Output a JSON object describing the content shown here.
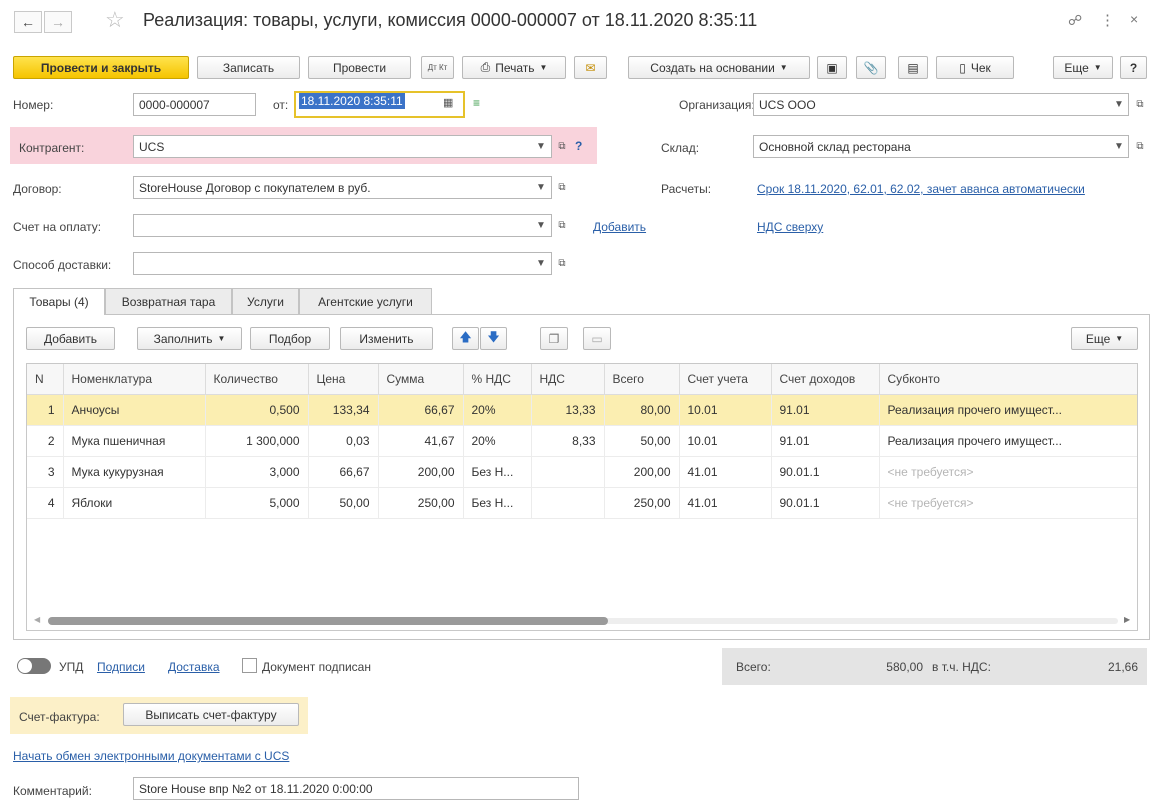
{
  "window": {
    "title": "Реализация: товары, услуги, комиссия 0000-000007 от 18.11.2020 8:35:11",
    "link_icon": "link-icon",
    "more_icon": "more-vertical-icon",
    "close_icon": "close-icon"
  },
  "toolbar": {
    "post_close": "Провести и закрыть",
    "save": "Записать",
    "post": "Провести",
    "dt_kt": "Дт Кт",
    "print": "Печать",
    "create_based": "Создать на основании",
    "receipt": "Чек",
    "more": "Еще",
    "help": "?"
  },
  "form": {
    "number_label": "Номер:",
    "number_value": "0000-000007",
    "date_label": "от:",
    "date_value": "18.11.2020  8:35:11",
    "organization_label": "Организация:",
    "organization_value": "UCS ООО",
    "counterparty_label": "Контрагент:",
    "counterparty_value": "UCS",
    "warehouse_label": "Склад:",
    "warehouse_value": "Основной склад ресторана",
    "contract_label": "Договор:",
    "contract_value": "StoreHouse Договор с покупателем в руб.",
    "settlements_label": "Расчеты:",
    "settlements_link": "Срок 18.11.2020, 62.01, 62.02, зачет аванса автоматически",
    "invoice_label": "Счет на оплату:",
    "invoice_value": "",
    "add_link": "Добавить",
    "vat_link": "НДС сверху",
    "delivery_label": "Способ доставки:",
    "delivery_value": ""
  },
  "tabs": [
    {
      "label": "Товары (4)"
    },
    {
      "label": "Возвратная тара"
    },
    {
      "label": "Услуги"
    },
    {
      "label": "Агентские услуги"
    }
  ],
  "table_toolbar": {
    "add": "Добавить",
    "fill": "Заполнить",
    "pick": "Подбор",
    "change": "Изменить",
    "more": "Еще"
  },
  "table": {
    "columns": [
      "N",
      "Номенклатура",
      "Количество",
      "Цена",
      "Сумма",
      "% НДС",
      "НДС",
      "Всего",
      "Счет учета",
      "Счет доходов",
      "Субконто"
    ],
    "rows": [
      {
        "n": "1",
        "name": "Анчоусы",
        "qty": "0,500",
        "price": "133,34",
        "sum": "66,67",
        "vat_rate": "20%",
        "vat": "13,33",
        "total": "80,00",
        "account": "10.01",
        "income": "91.01",
        "subconto": "Реализация прочего имущест..."
      },
      {
        "n": "2",
        "name": "Мука пшеничная",
        "qty": "1 300,000",
        "price": "0,03",
        "sum": "41,67",
        "vat_rate": "20%",
        "vat": "8,33",
        "total": "50,00",
        "account": "10.01",
        "income": "91.01",
        "subconto": "Реализация прочего имущест..."
      },
      {
        "n": "3",
        "name": "Мука кукурузная",
        "qty": "3,000",
        "price": "66,67",
        "sum": "200,00",
        "vat_rate": "Без Н...",
        "vat": "",
        "total": "200,00",
        "account": "41.01",
        "income": "90.01.1",
        "subconto": "<не требуется>"
      },
      {
        "n": "4",
        "name": "Яблоки",
        "qty": "5,000",
        "price": "50,00",
        "sum": "250,00",
        "vat_rate": "Без Н...",
        "vat": "",
        "total": "250,00",
        "account": "41.01",
        "income": "90.01.1",
        "subconto": "<не требуется>"
      }
    ]
  },
  "footer": {
    "upd_label": "УПД",
    "signatures_link": "Подписи",
    "delivery_link": "Доставка",
    "signed_label": "Документ подписан",
    "total_label": "Всего:",
    "total_value": "580,00",
    "vat_label": "в т.ч. НДС:",
    "vat_value": "21,66",
    "invoice_label": "Счет-фактура:",
    "invoice_button": "Выписать счет-фактуру",
    "edo_link": "Начать обмен электронными документами с UCS",
    "comment_label": "Комментарий:",
    "comment_value": "Store House впр №2 от 18.11.2020 0:00:00"
  },
  "colors": {
    "primary_button": "#f5c400",
    "selected_row": "#fbeeb1",
    "counterparty_highlight": "#f9d3dc",
    "link": "#2a5fa8",
    "invoice_panel": "#fcf0c8"
  }
}
